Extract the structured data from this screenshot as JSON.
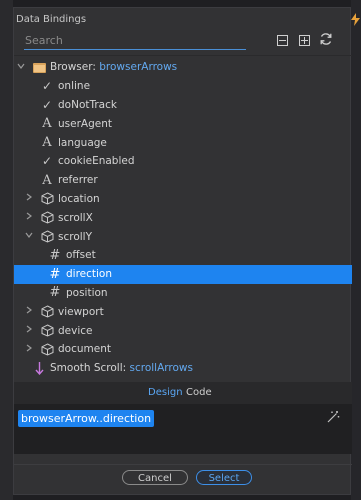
{
  "window": {
    "title": "Data Bindings"
  },
  "search": {
    "placeholder": "Search"
  },
  "toolbar": {
    "collapse_icon": "minus-box-icon",
    "expand_icon": "plus-box-icon",
    "refresh_icon": "refresh-icon"
  },
  "tree": {
    "root": {
      "prefix": "Browser:",
      "name": "browserArrows",
      "icon": "folder-icon"
    },
    "browser_children": [
      {
        "label": "online",
        "icon": "check-icon"
      },
      {
        "label": "doNotTrack",
        "icon": "check-icon"
      },
      {
        "label": "userAgent",
        "icon": "text-icon"
      },
      {
        "label": "language",
        "icon": "text-icon"
      },
      {
        "label": "cookieEnabled",
        "icon": "check-icon"
      },
      {
        "label": "referrer",
        "icon": "text-icon"
      },
      {
        "label": "location",
        "icon": "cube-icon"
      },
      {
        "label": "scrollX",
        "icon": "cube-icon"
      },
      {
        "label": "scrollY",
        "icon": "cube-icon"
      }
    ],
    "scrolly_children": [
      {
        "label": "offset",
        "icon": "hash-icon"
      },
      {
        "label": "direction",
        "icon": "hash-icon",
        "selected": true
      },
      {
        "label": "position",
        "icon": "hash-icon"
      }
    ],
    "browser_children_after": [
      {
        "label": "viewport",
        "icon": "cube-icon"
      },
      {
        "label": "device",
        "icon": "cube-icon"
      },
      {
        "label": "document",
        "icon": "cube-icon"
      }
    ],
    "smooth": {
      "prefix": "Smooth Scroll:",
      "name": "scrollArrows",
      "icon": "arrow-down-icon"
    }
  },
  "tabs": [
    {
      "label": "Design",
      "active": true
    },
    {
      "label": "Code",
      "active": false
    }
  ],
  "binding": {
    "value": "browserArrow..direction"
  },
  "footer": {
    "cancel_label": "Cancel",
    "select_label": "Select"
  },
  "colors": {
    "accent": "#1e84f0",
    "link": "#63a9f0",
    "panel": "#323234"
  }
}
